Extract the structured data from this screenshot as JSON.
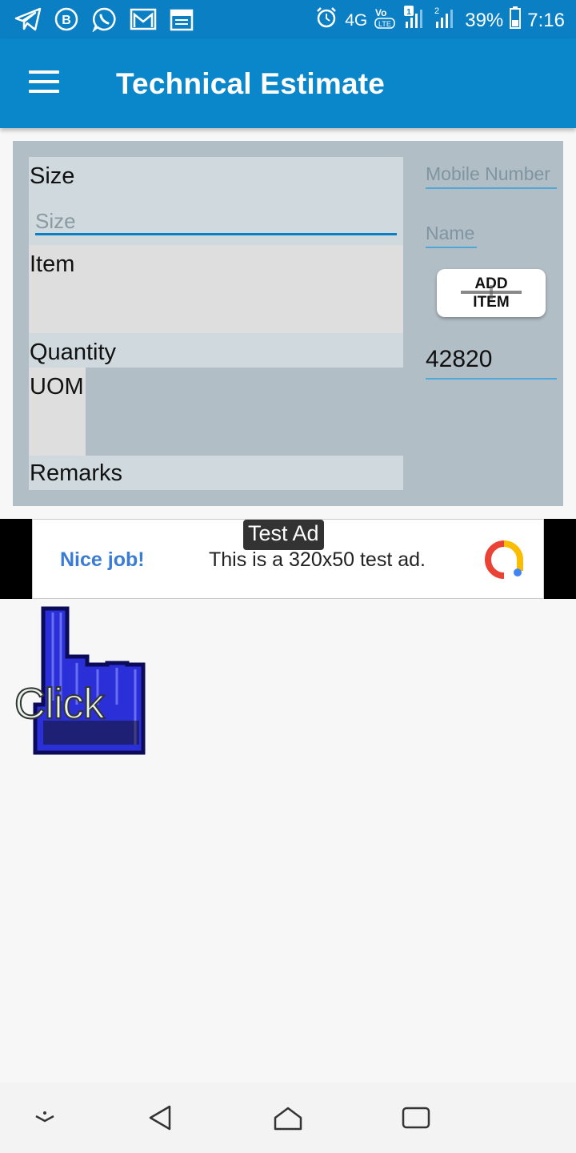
{
  "status_bar": {
    "left_icons": [
      "telegram-icon",
      "bbm-icon",
      "whatsapp-icon",
      "gmail-icon",
      "calendar-icon"
    ],
    "network": "4G",
    "volte": "VoLTE",
    "sim1": "1",
    "sim2": "2",
    "battery": "39%",
    "time": "7:16"
  },
  "app_bar": {
    "title": "Technical Estimate",
    "menu_icon": "hamburger-menu-icon"
  },
  "form": {
    "size_label": "Size",
    "size_placeholder": "Size",
    "item_label": "Item",
    "quantity_label": "Quantity",
    "uom_label": "UOM",
    "remarks_label": "Remarks",
    "mobile_placeholder": "Mobile Number",
    "name_placeholder": "Name",
    "add_item_label": "ADD ITEM",
    "value": "42820"
  },
  "ad": {
    "tag": "Test Ad",
    "nice": "Nice job!",
    "text": "This is a 320x50 test ad."
  },
  "click_graphic": {
    "text": "Click"
  },
  "nav_bar": {
    "icons": [
      "hide-keyboard-icon",
      "back-icon",
      "home-icon",
      "recents-icon"
    ]
  },
  "colors": {
    "primary": "#0a86cb",
    "status_bar": "#0a7fc4",
    "panel": "#b1bec5"
  }
}
